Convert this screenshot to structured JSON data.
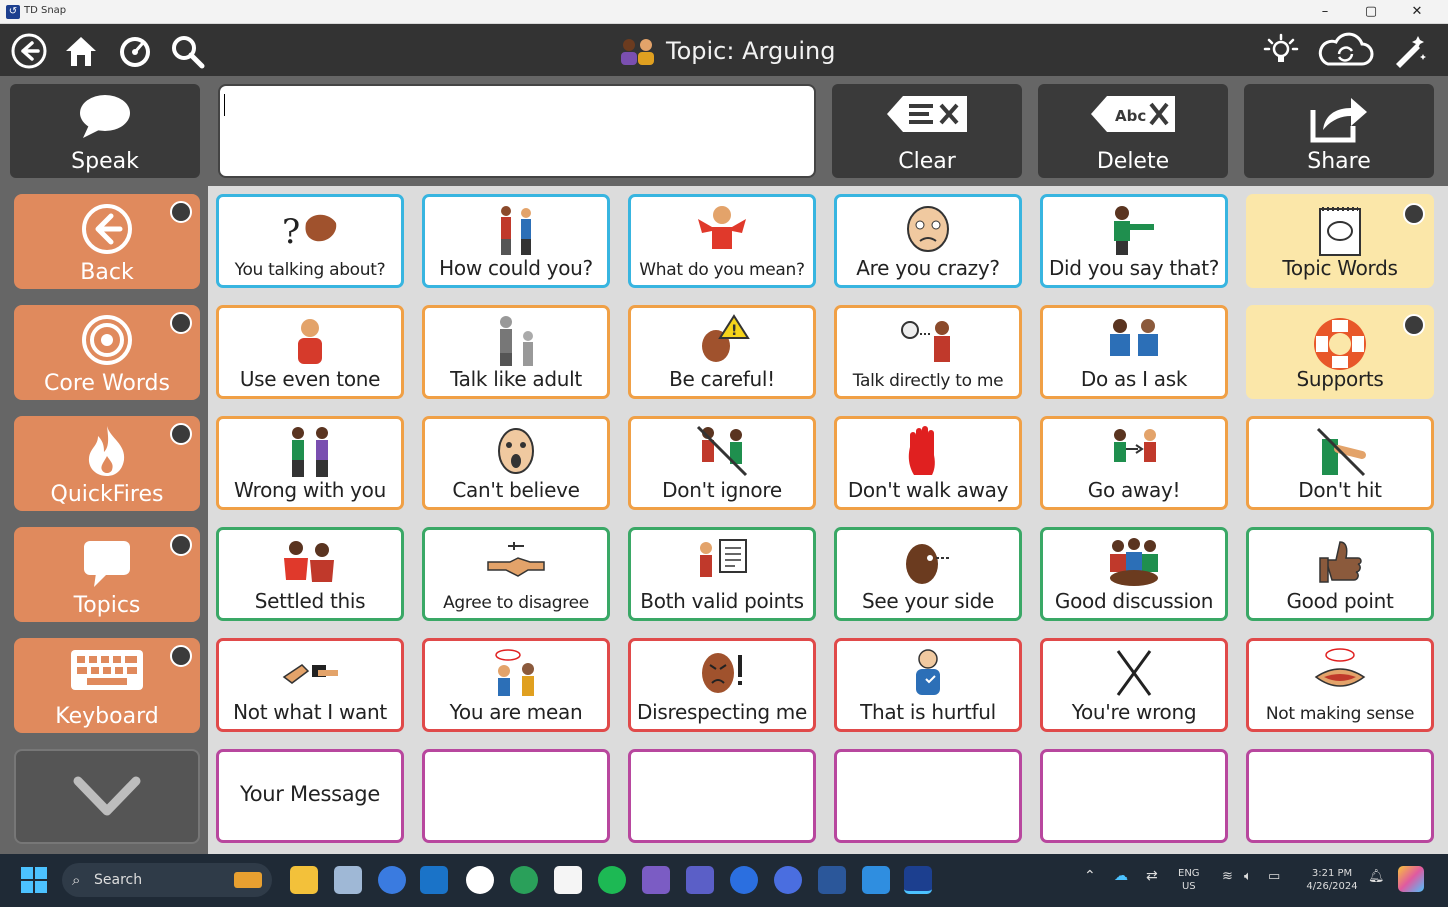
{
  "window": {
    "app_name": "TD Snap",
    "minimize": "–",
    "maximize": "▢",
    "close": "✕"
  },
  "topbar": {
    "topic_title": "Topic: Arguing"
  },
  "toolbar": {
    "speak_label": "Speak",
    "clear_label": "Clear",
    "delete_label": "Delete",
    "share_label": "Share",
    "message_text": ""
  },
  "nav": {
    "items": [
      {
        "label": "Back"
      },
      {
        "label": "Core Words"
      },
      {
        "label": "QuickFires"
      },
      {
        "label": "Topics"
      },
      {
        "label": "Keyboard"
      }
    ]
  },
  "grid": {
    "rows": [
      [
        "You talking about?",
        "How could you?",
        "What do you mean?",
        "Are you crazy?",
        "Did you say that?",
        "Topic Words"
      ],
      [
        "Use even tone",
        "Talk like adult",
        "Be careful!",
        "Talk directly to me",
        "Do as I ask",
        "Supports"
      ],
      [
        "Wrong with you",
        "Can't believe",
        "Don't ignore",
        "Don't walk away",
        "Go away!",
        "Don't hit"
      ],
      [
        "Settled this",
        "Agree to disagree",
        "Both valid points",
        "See your side",
        "Good discussion",
        "Good point"
      ],
      [
        "Not what I want",
        "You are mean",
        "Disrespecting me",
        "That is hurtful",
        "You're wrong",
        "Not making sense"
      ],
      [
        "Your Message",
        "",
        "",
        "",
        "",
        ""
      ]
    ]
  },
  "taskbar": {
    "search_placeholder": "Search",
    "lang_top": "ENG",
    "lang_bottom": "US",
    "time": "3:21 PM",
    "date": "4/26/2024"
  },
  "colors": {
    "nav_orange": "#e08a5d",
    "border_blue": "#38b5e0",
    "border_orange": "#f0a046",
    "border_green": "#3aa866",
    "border_red": "#e04a4a",
    "border_purple": "#b8479e",
    "folder_yellow": "#fbe7a9"
  }
}
